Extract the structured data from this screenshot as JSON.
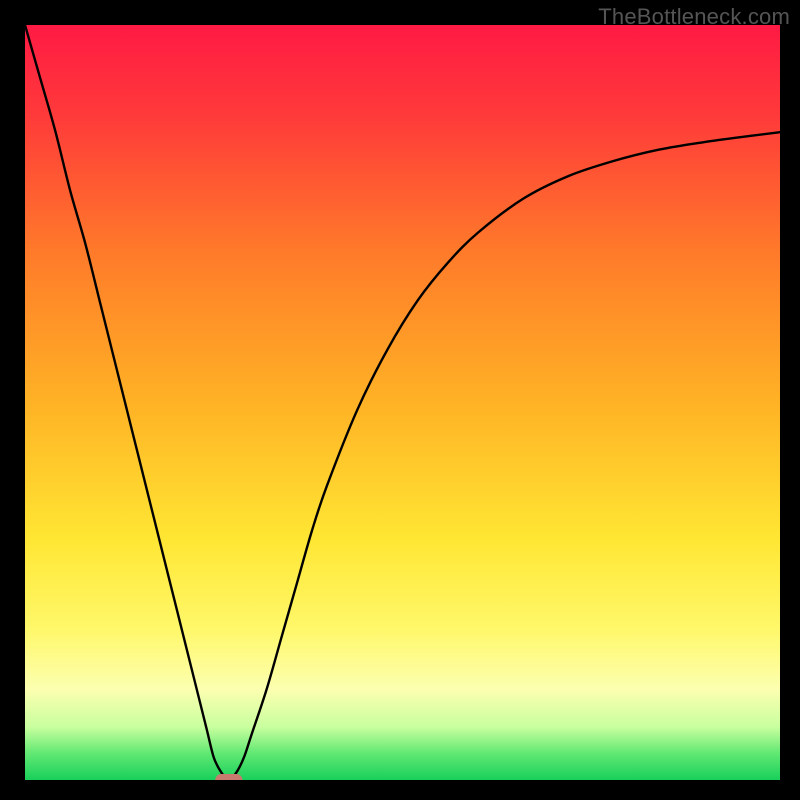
{
  "watermark": "TheBottleneck.com",
  "chart_data": {
    "type": "line",
    "title": "",
    "xlabel": "",
    "ylabel": "",
    "xlim": [
      0,
      100
    ],
    "ylim": [
      0,
      100
    ],
    "background_gradient": {
      "stops": [
        {
          "offset": 0.0,
          "color": "#ff1a44"
        },
        {
          "offset": 0.12,
          "color": "#ff3a3a"
        },
        {
          "offset": 0.3,
          "color": "#ff7a2a"
        },
        {
          "offset": 0.5,
          "color": "#ffb225"
        },
        {
          "offset": 0.68,
          "color": "#ffe633"
        },
        {
          "offset": 0.8,
          "color": "#fff86a"
        },
        {
          "offset": 0.88,
          "color": "#fcffb0"
        },
        {
          "offset": 0.93,
          "color": "#c8ff9e"
        },
        {
          "offset": 0.965,
          "color": "#60e873"
        },
        {
          "offset": 1.0,
          "color": "#18d05a"
        }
      ]
    },
    "series": [
      {
        "name": "bottleneck-curve",
        "x": [
          0,
          2,
          4,
          6,
          8,
          10,
          12,
          14,
          16,
          18,
          20,
          22,
          24,
          25,
          26,
          27,
          28,
          29,
          30,
          32,
          34,
          36,
          38,
          40,
          44,
          48,
          52,
          56,
          60,
          66,
          72,
          78,
          84,
          90,
          96,
          100
        ],
        "y": [
          100,
          93,
          86,
          78,
          71,
          63,
          55,
          47,
          39,
          31,
          23,
          15,
          7,
          3,
          1,
          0,
          1,
          3,
          6,
          12,
          19,
          26,
          33,
          39,
          49,
          57,
          63.5,
          68.5,
          72.5,
          77,
          80,
          82,
          83.5,
          84.5,
          85.3,
          85.8
        ]
      }
    ],
    "marker": {
      "shape": "capsule",
      "x": 27,
      "y": 0,
      "width": 3.6,
      "height": 1.6,
      "fill": "#c97a6e"
    }
  }
}
